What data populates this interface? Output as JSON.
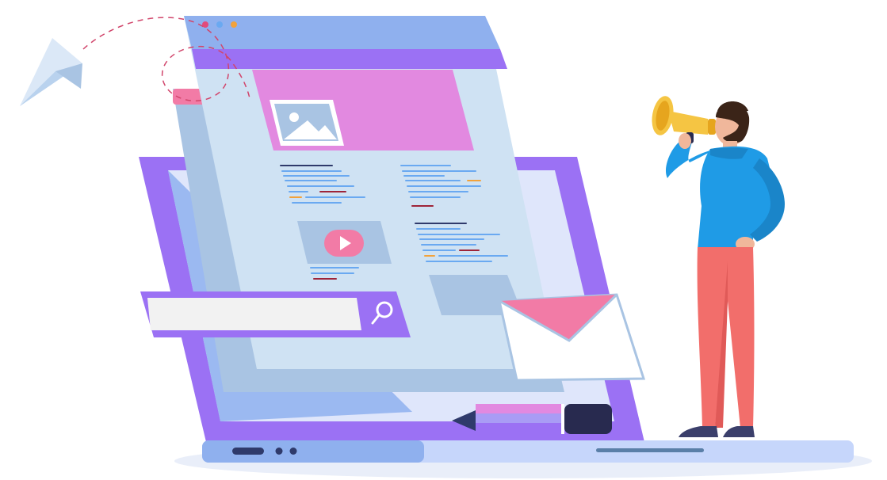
{
  "illustration": {
    "theme": "online marketing / web page illustration",
    "elements": [
      "paper-plane-icon",
      "browser-window",
      "image-placeholder-icon",
      "play-button-icon",
      "search-bar",
      "search-icon",
      "envelope-icon",
      "pen-marker-icon",
      "laptop",
      "person-with-megaphone",
      "megaphone-icon"
    ]
  },
  "search": {
    "value": "",
    "placeholder": ""
  },
  "colors": {
    "purple": "#9b71f4",
    "lavender": "#a99cf5",
    "light_blue_panel": "#cfe2f3",
    "mid_blue": "#a9c4e3",
    "pink": "#e289e0",
    "hot_pink": "#f27ba6",
    "dark_navy": "#282a4f",
    "shirt_blue": "#1f9be6",
    "pants_coral": "#f26e6b",
    "megaphone_yellow": "#f5c543",
    "dash_red": "#d1456b"
  }
}
